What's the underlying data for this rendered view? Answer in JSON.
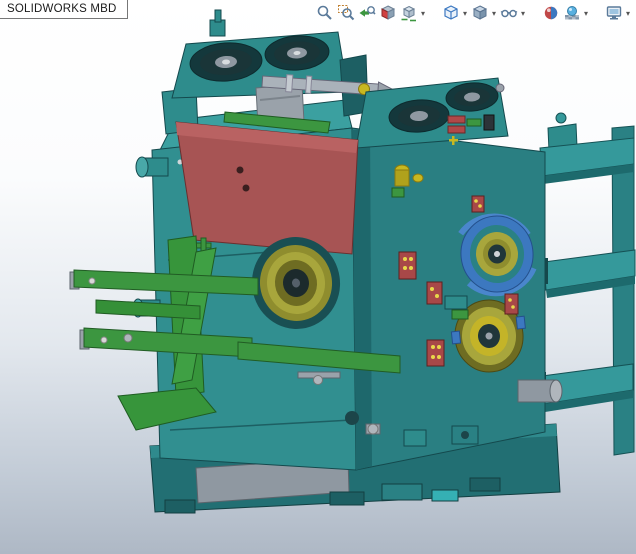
{
  "app": {
    "badge_label": "SOLIDWORKS MBD"
  },
  "heads_up_toolbar": {
    "items": [
      {
        "icon": "zoom-to-fit-icon",
        "dropdown": false
      },
      {
        "icon": "zoom-to-area-icon",
        "dropdown": false
      },
      {
        "icon": "previous-view-icon",
        "dropdown": false
      },
      {
        "icon": "section-view-icon",
        "dropdown": false
      },
      {
        "icon": "annotation-views-icon",
        "dropdown": true
      },
      {
        "icon": "view-orientation-icon",
        "dropdown": true
      },
      {
        "icon": "display-style-icon",
        "dropdown": true
      },
      {
        "icon": "hide-show-items-icon",
        "dropdown": true
      },
      {
        "icon": "edit-appearance-icon",
        "dropdown": false
      },
      {
        "icon": "apply-scene-icon",
        "dropdown": true
      },
      {
        "icon": "view-settings-icon",
        "dropdown": true
      }
    ]
  },
  "viewport": {
    "background_top_color": "#ffffff",
    "background_bottom_color": "#aeb8c5",
    "model_colors": {
      "body_teal": "#2e8c8c",
      "body_teal_light": "#49a8a8",
      "body_teal_dark": "#1e6a6e",
      "plate_red": "#a75454",
      "arm_green": "#3c9640",
      "bearing_olive": "#a8a63c",
      "bearing_blue": "#3c78c0",
      "metal_gray": "#9aa2aa",
      "accent_yellow": "#c8b820"
    }
  }
}
